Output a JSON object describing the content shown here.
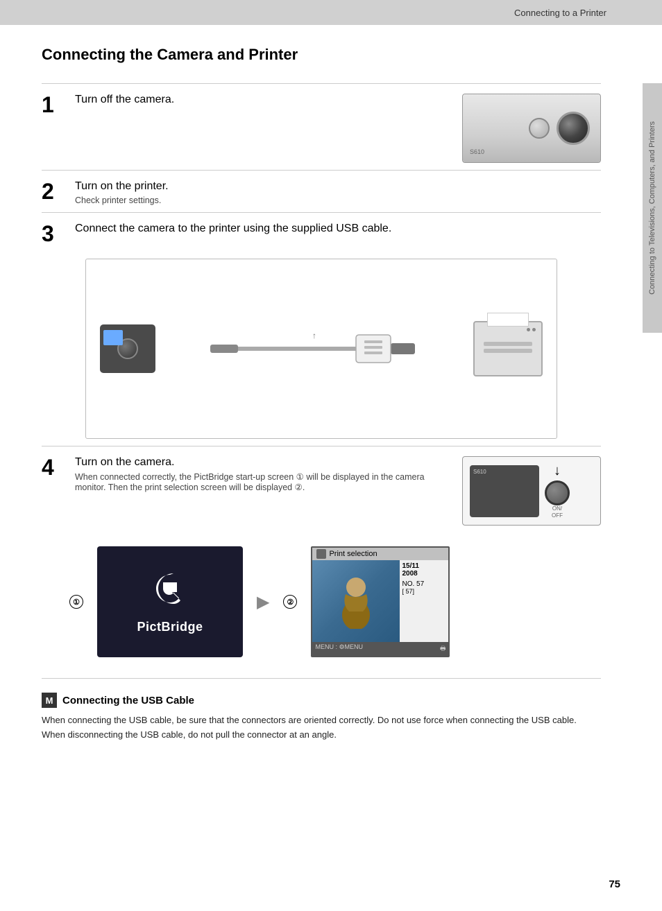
{
  "header": {
    "title": "Connecting to a Printer",
    "background_color": "#d0d0d0"
  },
  "sidebar": {
    "label": "Connecting to Televisions, Computers, and Printers"
  },
  "page": {
    "heading": "Connecting the Camera and Printer",
    "number": "75"
  },
  "steps": [
    {
      "number": "1",
      "title": "Turn off the camera.",
      "sub": "",
      "has_image": true
    },
    {
      "number": "2",
      "title": "Turn on the printer.",
      "sub": "Check printer settings.",
      "has_image": false
    },
    {
      "number": "3",
      "title": "Connect the camera to the printer using the supplied USB cable.",
      "sub": "",
      "has_image": true
    },
    {
      "number": "4",
      "title": "Turn on the camera.",
      "sub": "When connected correctly, the PictBridge start-up screen ① will be displayed in the camera monitor. Then the print selection screen will be displayed ②.",
      "has_image": true
    }
  ],
  "screens": {
    "pictbridge": {
      "circle_num": "①",
      "logo_symbol": "⟨",
      "brand_name": "PictBridge"
    },
    "print_selection": {
      "circle_num": "②",
      "header_label": "Print selection",
      "date": "15/11\n2008",
      "no_label": "NO. 57",
      "no_value": "[ 57]",
      "footer_left": "MENU : ⚙MENU",
      "footer_right": "🖶"
    }
  },
  "note": {
    "icon_label": "M",
    "title": "Connecting the USB Cable",
    "body": "When connecting the USB cable, be sure that the connectors are oriented correctly. Do not use force when connecting the USB cable. When disconnecting the USB cable, do not pull the connector at an angle."
  },
  "camera": {
    "model": "S610"
  }
}
